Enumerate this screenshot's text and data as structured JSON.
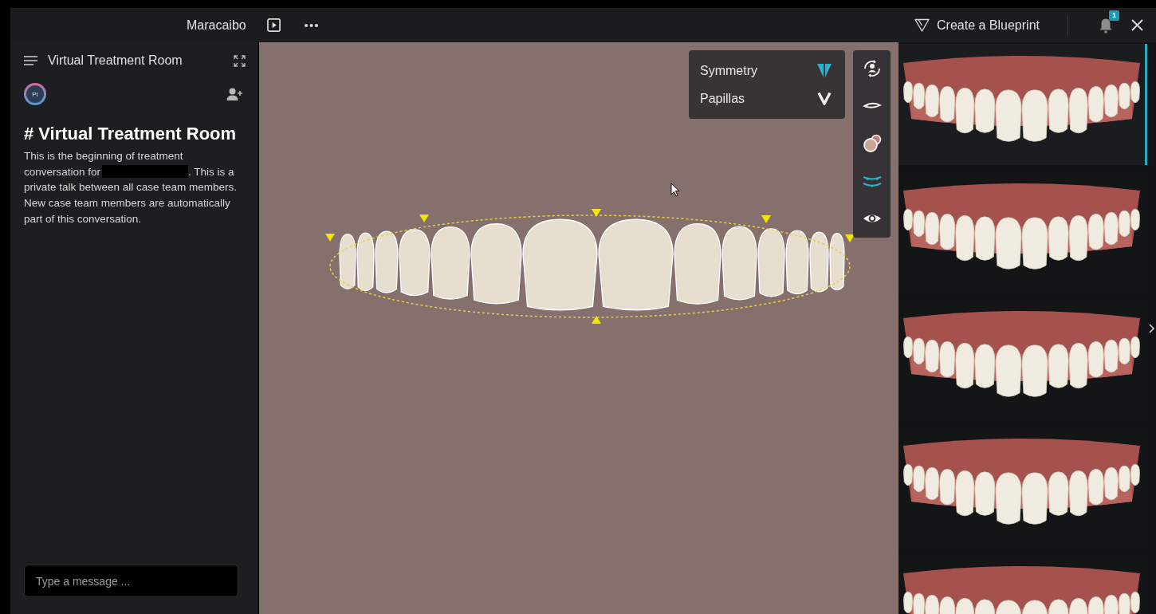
{
  "top_bar": {
    "title": "Maracaibo",
    "blueprint_button": "Create a Blueprint",
    "notification_count": "1"
  },
  "chat_panel": {
    "title": "Virtual Treatment Room",
    "avatar_initials": "PI",
    "heading": "# Virtual Treatment Room",
    "intro_before": "This is the beginning of treatment conversation for",
    "intro_after": ". This is a private talk between all case team members. New case team members are automatically part of this conversation.",
    "message_field": {
      "placeholder": "Type a message ..."
    }
  },
  "view_options": [
    {
      "label": "Symmetry",
      "kind": "symmetry",
      "on": true
    },
    {
      "label": "Papillas",
      "kind": "papillas",
      "on": false
    }
  ],
  "tools": [
    {
      "kind": "rotate",
      "selected": false
    },
    {
      "kind": "lip",
      "selected": false
    },
    {
      "kind": "color",
      "selected": false
    },
    {
      "kind": "curve",
      "selected": true
    },
    {
      "kind": "eye",
      "selected": false
    }
  ],
  "thumbnails": [
    {
      "selected": true
    },
    {
      "selected": false
    },
    {
      "selected": false
    },
    {
      "selected": false
    },
    {
      "selected": false
    }
  ]
}
